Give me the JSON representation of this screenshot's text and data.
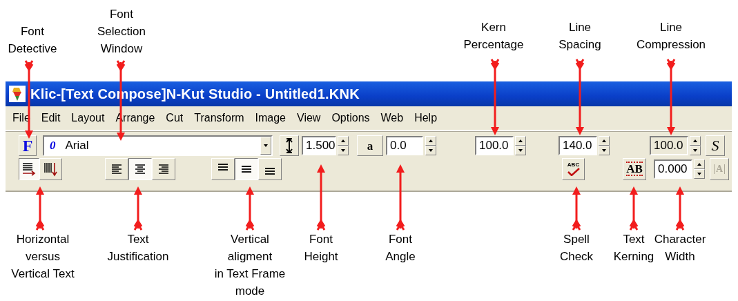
{
  "window": {
    "title": "Klic-[Text Compose]N-Kut Studio - Untitled1.KNK"
  },
  "menu": [
    "File",
    "Edit",
    "Layout",
    "Arrange",
    "Cut",
    "Transform",
    "Image",
    "View",
    "Options",
    "Web",
    "Help"
  ],
  "toolbar": {
    "font_detective": {
      "glyph": "F"
    },
    "font_select": {
      "type_mark": "0",
      "value": "Arial"
    },
    "font_height": {
      "value": "1.500"
    },
    "font_angle": {
      "glyph": "a",
      "value": "0.0"
    },
    "kern_percentage": {
      "value": "100.0"
    },
    "line_spacing": {
      "value": "140.0"
    },
    "line_compression": {
      "value": "100.0",
      "disabled": true
    },
    "style_button": {
      "glyph": "S"
    },
    "direction": [
      {
        "selected": true
      },
      {
        "selected": false
      }
    ],
    "justify": [
      {
        "selected": false
      },
      {
        "selected": true
      },
      {
        "selected": false
      }
    ],
    "vertical_align": [
      {
        "selected": false
      },
      {
        "selected": true
      },
      {
        "selected": false
      }
    ],
    "spell_check": {
      "glyph": "ABC"
    },
    "kerning": {
      "glyph": "AB"
    },
    "character_width": {
      "value": "0.000"
    },
    "frame_button": {
      "glyph": "A",
      "disabled": true
    }
  },
  "top_callouts": [
    {
      "text": "Font\nDetective"
    },
    {
      "text": "Font\nSelection\nWindow"
    },
    {
      "text": "Kern\nPercentage"
    },
    {
      "text": "Line\nSpacing"
    },
    {
      "text": "Line\nCompression"
    }
  ],
  "bottom_callouts": [
    {
      "text": "Horizontal\nversus\nVertical Text"
    },
    {
      "text": "Text\nJustification"
    },
    {
      "text": "Vertical\naligment\nin Text Frame\nmode"
    },
    {
      "text": "Font\nHeight"
    },
    {
      "text": "Font\nAngle"
    },
    {
      "text": "Spell\nCheck"
    },
    {
      "text": "Text\nKerning"
    },
    {
      "text": "Character\nWidth"
    }
  ]
}
